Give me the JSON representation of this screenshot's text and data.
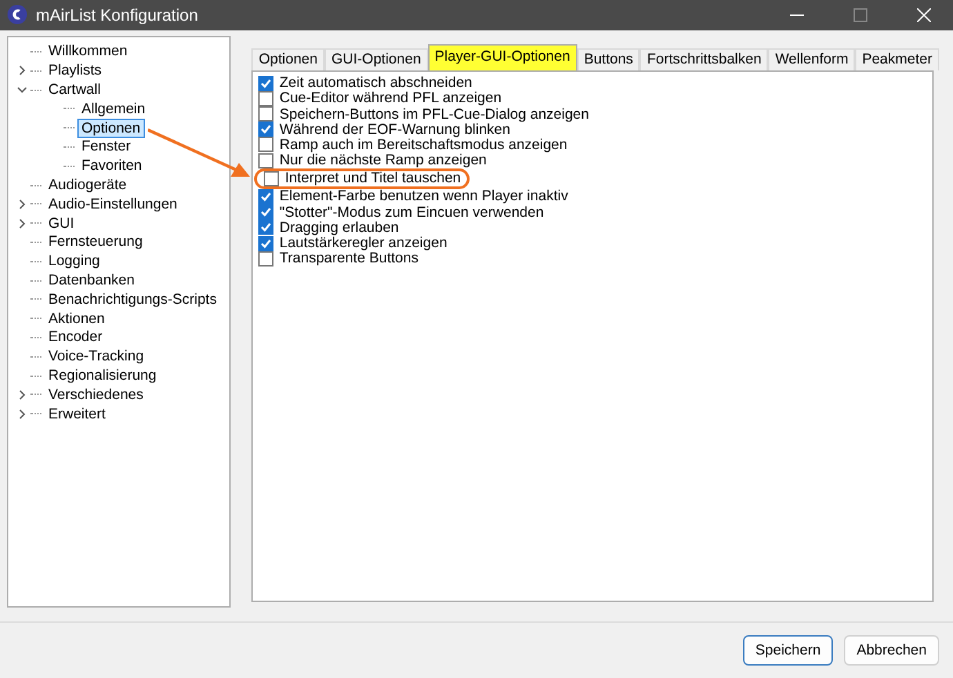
{
  "window": {
    "title": "mAirList Konfiguration"
  },
  "sidebar": {
    "items": [
      {
        "label": "Willkommen",
        "selected": false
      },
      {
        "label": "Playlists",
        "selected": false,
        "expanded": false
      },
      {
        "label": "Cartwall",
        "selected": false,
        "expanded": true,
        "children": [
          {
            "label": "Allgemein",
            "selected": false
          },
          {
            "label": "Optionen",
            "selected": true
          },
          {
            "label": "Fenster",
            "selected": false
          },
          {
            "label": "Favoriten",
            "selected": false
          }
        ]
      },
      {
        "label": "Audiogeräte",
        "selected": false
      },
      {
        "label": "Audio-Einstellungen",
        "selected": false,
        "expanded": false
      },
      {
        "label": "GUI",
        "selected": false,
        "expanded": false
      },
      {
        "label": "Fernsteuerung",
        "selected": false
      },
      {
        "label": "Logging",
        "selected": false
      },
      {
        "label": "Datenbanken",
        "selected": false
      },
      {
        "label": "Benachrichtigungs-Scripts",
        "selected": false
      },
      {
        "label": "Aktionen",
        "selected": false
      },
      {
        "label": "Encoder",
        "selected": false
      },
      {
        "label": "Voice-Tracking",
        "selected": false
      },
      {
        "label": "Regionalisierung",
        "selected": false
      },
      {
        "label": "Verschiedenes",
        "selected": false,
        "expanded": false
      },
      {
        "label": "Erweitert",
        "selected": false,
        "expanded": false
      }
    ]
  },
  "tabs": [
    {
      "label": "Optionen",
      "selected": false
    },
    {
      "label": "GUI-Optionen",
      "selected": false
    },
    {
      "label": "Player-GUI-Optionen",
      "selected": true
    },
    {
      "label": "Buttons",
      "selected": false
    },
    {
      "label": "Fortschrittsbalken",
      "selected": false
    },
    {
      "label": "Wellenform",
      "selected": false
    },
    {
      "label": "Peakmeter",
      "selected": false
    }
  ],
  "options": [
    {
      "label": "Zeit automatisch abschneiden",
      "checked": true
    },
    {
      "label": "Cue-Editor während PFL anzeigen",
      "checked": false
    },
    {
      "label": "Speichern-Buttons im PFL-Cue-Dialog anzeigen",
      "checked": false
    },
    {
      "label": "Während der EOF-Warnung blinken",
      "checked": true
    },
    {
      "label": "Ramp auch im Bereitschaftsmodus anzeigen",
      "checked": false
    },
    {
      "label": "Nur die nächste Ramp anzeigen",
      "checked": false
    },
    {
      "label": "Interpret und Titel tauschen",
      "checked": false,
      "annotated": true
    },
    {
      "label": "Element-Farbe benutzen wenn Player inaktiv",
      "checked": true
    },
    {
      "label": "\"Stotter\"-Modus zum Eincuen verwenden",
      "checked": true
    },
    {
      "label": "Dragging erlauben",
      "checked": true
    },
    {
      "label": "Lautstärkeregler anzeigen",
      "checked": true
    },
    {
      "label": "Transparente Buttons",
      "checked": false
    }
  ],
  "buttons": [
    {
      "label": "Speichern",
      "default": true
    },
    {
      "label": "Abbrechen",
      "default": false
    }
  ]
}
